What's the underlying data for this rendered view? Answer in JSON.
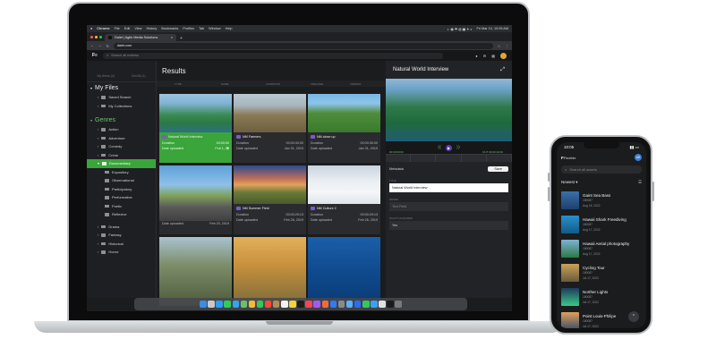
{
  "menubar": {
    "items": [
      "Chrome",
      "File",
      "Edit",
      "View",
      "History",
      "Bookmarks",
      "Profiles",
      "Tab",
      "Window",
      "Help"
    ],
    "clock": "Fri Mar 10, 10:05 AM"
  },
  "browser": {
    "tab_title": "Dalet | Agile Media Solutions",
    "url": "dalet.com"
  },
  "app": {
    "search_placeholder": "Search all reviews"
  },
  "sidebar": {
    "head": [
      "My Items (2)",
      "Get All (1)"
    ],
    "my_files": "My Files",
    "my_files_items": [
      "Saved Search",
      "My Collections"
    ],
    "genres": "Genres",
    "genre_items": [
      "Action",
      "Adventure",
      "Comedy",
      "Crime",
      "Documentary"
    ],
    "documentary_sub": [
      "Expository",
      "Observational",
      "Participatory",
      "Performative",
      "Poetic",
      "Reflexive"
    ],
    "more_genres": [
      "Drama",
      "Fantasy",
      "Historical",
      "Horror"
    ]
  },
  "results": {
    "title": "Results",
    "columns": [
      "TYPE",
      "NAME",
      "DURATION",
      "CREATED",
      "FORMAT"
    ],
    "cards": [
      {
        "title": "Natural World Interview",
        "duration_label": "Duration",
        "duration": "00:00:00",
        "uploaded_label": "Date uploaded",
        "uploaded": "Feb 1, 20"
      },
      {
        "title": "NM Farmers",
        "duration_label": "Duration",
        "duration": "00:00:30:00",
        "uploaded_label": "Date uploaded",
        "uploaded": "Jan 31, 2019"
      },
      {
        "title": "NM close up",
        "duration_label": "Duration",
        "duration": "00:00:30:00",
        "uploaded_label": "Date uploaded",
        "uploaded": "Jan 31, 2019"
      },
      {
        "title": "",
        "duration_label": "",
        "duration": "",
        "uploaded_label": "Date uploaded",
        "uploaded": "Feb 20, 2019"
      },
      {
        "title": "NM Summer Field",
        "duration_label": "Duration",
        "duration": "00:00:25:13",
        "uploaded_label": "Date uploaded",
        "uploaded": "Feb 26, 2019"
      },
      {
        "title": "NM Culture 2",
        "duration_label": "Duration",
        "duration": "00:00:29:13",
        "uploaded_label": "Date uploaded",
        "uploaded": "Feb 26, 2019"
      }
    ]
  },
  "detail": {
    "title": "Natural World Interview",
    "tc_in": "00:00:00:00",
    "tc_out": "OUT 00:00:10:00",
    "metadata_label": "Metadata",
    "save_label": "Save",
    "field1_label": "TITLE",
    "field1_value": "Natural World Interview",
    "field2_label": "GENRE",
    "field2_value": "Text Field",
    "field3_label": "RIGHTS ACQUIRED",
    "field3_value": "Yes"
  },
  "phone": {
    "time": "10:05",
    "brand": "Flexible",
    "avatar": "AR",
    "search_placeholder": "Search all assets",
    "sort_label": "Newest",
    "items": [
      {
        "name": "Gaint Sea Bass",
        "id": "180087",
        "date": "Aug 18, 2022"
      },
      {
        "name": "Hawaii Shark Freediving",
        "id": "180087",
        "date": "Aug 17, 2022"
      },
      {
        "name": "Hawaii Aerial photography",
        "id": "180087",
        "date": "Aug 17, 2022"
      },
      {
        "name": "Cycling Tour",
        "id": "180087",
        "date": "Jul 17, 2022"
      },
      {
        "name": "Norther Lights",
        "id": "180087",
        "date": "Jul 17, 2022"
      },
      {
        "name": "Point Louis-Philipe",
        "id": "180087",
        "date": "Jul 17, 2022"
      }
    ]
  },
  "colors": {
    "accent_green": "#3aa53a",
    "app_bg": "#1b1c1e"
  }
}
